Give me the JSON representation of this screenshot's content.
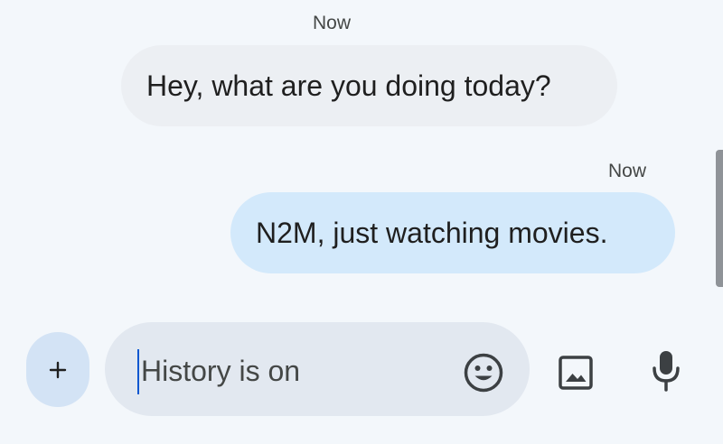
{
  "thread": {
    "messages": [
      {
        "direction": "incoming",
        "timestamp": "Now",
        "text": "Hey, what are you doing today?"
      },
      {
        "direction": "outgoing",
        "timestamp": "Now",
        "text": "N2M, just watching movies."
      }
    ]
  },
  "compose": {
    "placeholder": "History is on",
    "value": "",
    "icons": {
      "attach": "plus-icon",
      "emoji": "emoji-icon",
      "gallery": "image-icon",
      "voice": "microphone-icon"
    }
  },
  "colors": {
    "background": "#f3f7fb",
    "incoming_bubble": "#eceff3",
    "outgoing_bubble": "#d3e9fb",
    "input_pill": "#e2e8f0",
    "attach_button": "#d3e3f5",
    "caret": "#0b57d0",
    "icon": "#3c4043"
  }
}
